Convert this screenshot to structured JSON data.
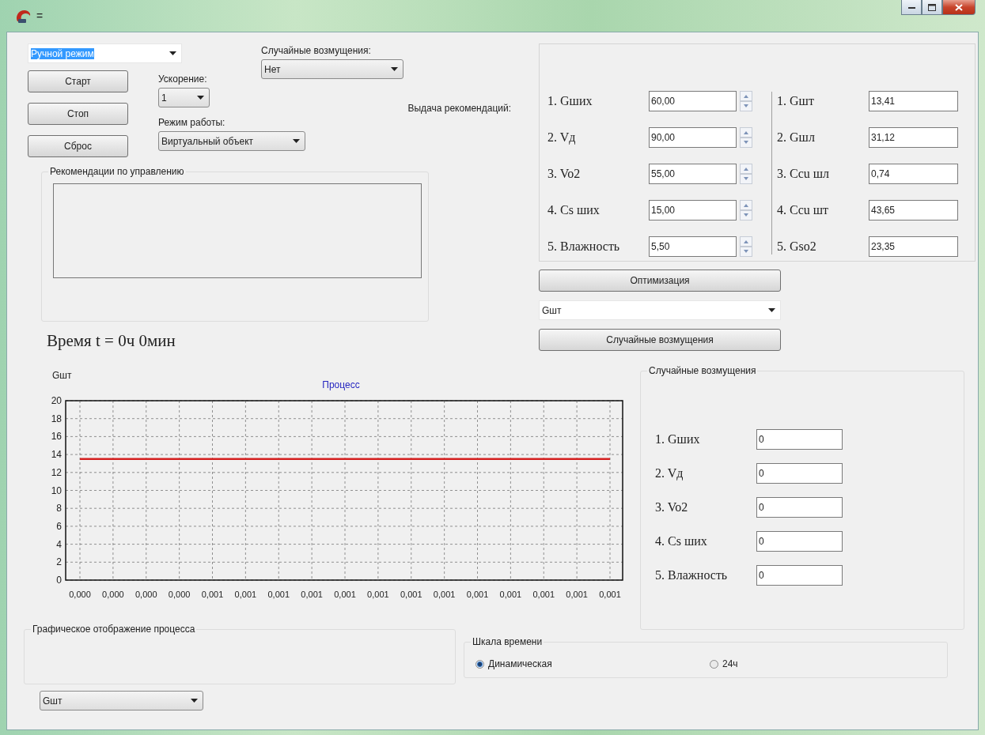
{
  "window": {
    "title": "="
  },
  "mode_select": {
    "value": "Ручной режим",
    "kind": "editable",
    "text_highlighted": true
  },
  "buttons": [
    "Старт",
    "Стоп",
    "Сброс"
  ],
  "acceleration": {
    "label": "Ускорение:",
    "value": "1",
    "kind": "dropdown"
  },
  "work_mode": {
    "label": "Режим работы:",
    "value": "Виртуальный объект",
    "kind": "dropdown"
  },
  "random_disturbance": {
    "label": "Случайные возмущения:",
    "value": "Нет",
    "kind": "dropdown"
  },
  "recommendations_label": "Выдача рекомендаций:",
  "recommendations_group": {
    "title": "Рекомендации по управлению"
  },
  "time_text": "Время t = 0ч 0мин",
  "inputs": [
    {
      "label": "1. Gших",
      "value": "60,00"
    },
    {
      "label": "2. Vд",
      "value": "90,00"
    },
    {
      "label": "3. Vo2",
      "value": "55,00"
    },
    {
      "label": "4. Cs ших",
      "value": "15,00"
    },
    {
      "label": "5. Влажность",
      "value": "5,50"
    }
  ],
  "outputs": [
    {
      "label": "1. Gшт",
      "value": "13,41"
    },
    {
      "label": "2. Gшл",
      "value": "31,12"
    },
    {
      "label": "3. Ccu шл",
      "value": "0,74"
    },
    {
      "label": "4. Ccu шт",
      "value": "43,65"
    },
    {
      "label": "5. Gso2",
      "value": "23,35"
    }
  ],
  "optimize_button": "Оптимизация",
  "output_select": {
    "value": "Gшт",
    "kind": "editable"
  },
  "random_button": "Случайные возмущения",
  "chart": {
    "chart_data": {
      "type": "line",
      "title": "Процесс",
      "ylabel": "Gшт",
      "categories": [
        "0,000",
        "0,000",
        "0,000",
        "0,000",
        "0,001",
        "0,001",
        "0,001",
        "0,001",
        "0,001",
        "0,001",
        "0,001",
        "0,001",
        "0,001",
        "0,001",
        "0,001",
        "0,001",
        "0,001"
      ],
      "grid": true,
      "series": [
        {
          "color": "#d42020",
          "values": [
            13.5,
            13.5,
            13.5,
            13.5,
            13.5,
            13.5,
            13.5,
            13.5,
            13.5,
            13.5,
            13.5,
            13.5,
            13.5,
            13.5,
            13.5,
            13.5,
            13.5
          ]
        }
      ],
      "ylim": [
        0,
        20
      ],
      "yticks": [
        0,
        2,
        4,
        6,
        8,
        10,
        12,
        14,
        16,
        18,
        20
      ]
    }
  },
  "random_group": {
    "title": "Случайные возмущения",
    "rows": [
      {
        "label": "1. Gших",
        "value": "0"
      },
      {
        "label": "2. Vд",
        "value": "0"
      },
      {
        "label": "3. Vo2",
        "value": "0"
      },
      {
        "label": "4. Cs ших",
        "value": "0"
      },
      {
        "label": "5. Влажность",
        "value": "0"
      }
    ]
  },
  "graph_group": {
    "title": "Графическое отображение процесса"
  },
  "graph_select": {
    "value": "Gшт",
    "kind": "dropdown"
  },
  "time_scale": {
    "title": "Шкала времени",
    "options": [
      {
        "label": "Динамическая",
        "selected": true
      },
      {
        "label": "24ч",
        "selected": false
      }
    ]
  }
}
